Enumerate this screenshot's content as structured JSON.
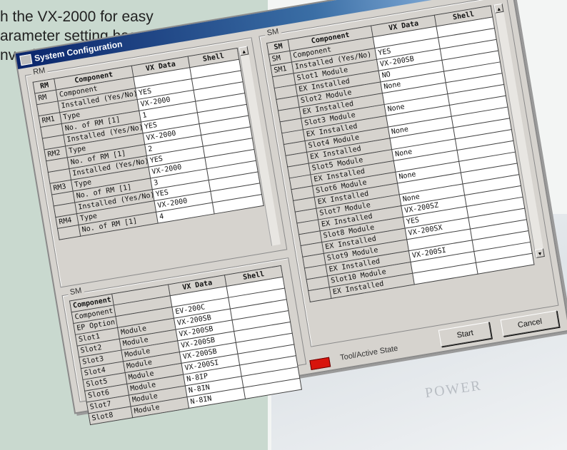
{
  "intro_lines": [
    "h the VX-2000 for easy",
    "arameter setting has",
    "nvenient use by"
  ],
  "background_text": "POWER",
  "window": {
    "title": "System Configuration",
    "close_label": "×",
    "start_label": "Start",
    "cancel_label": "Cancel",
    "status_label": "Tool/Active State",
    "status_color": "#d8140c"
  },
  "panel_left_top": {
    "label": "RM",
    "headers": [
      "RM",
      "Component",
      "VX Data",
      "Shell"
    ],
    "rows": [
      {
        "group": "RM",
        "item": "Component",
        "data": "",
        "shell": ""
      },
      {
        "group": "",
        "item": "Installed (Yes/No)",
        "data": "YES",
        "shell": ""
      },
      {
        "group": "RM1",
        "item": "Type",
        "data": "VX-2000",
        "shell": ""
      },
      {
        "group": "",
        "item": "No. of RM [1]",
        "data": "1",
        "shell": ""
      },
      {
        "group": "",
        "item": "Installed (Yes/No)",
        "data": "YES",
        "shell": ""
      },
      {
        "group": "RM2",
        "item": "Type",
        "data": "VX-2000",
        "shell": ""
      },
      {
        "group": "",
        "item": "No. of RM [1]",
        "data": "2",
        "shell": ""
      },
      {
        "group": "",
        "item": "Installed (Yes/No)",
        "data": "YES",
        "shell": ""
      },
      {
        "group": "RM3",
        "item": "Type",
        "data": "VX-2000",
        "shell": ""
      },
      {
        "group": "",
        "item": "No. of RM [1]",
        "data": "3",
        "shell": ""
      },
      {
        "group": "",
        "item": "Installed (Yes/No)",
        "data": "YES",
        "shell": ""
      },
      {
        "group": "RM4",
        "item": "Type",
        "data": "VX-2000",
        "shell": ""
      },
      {
        "group": "",
        "item": "No. of RM [1]",
        "data": "4",
        "shell": ""
      }
    ]
  },
  "panel_left_bottom": {
    "label": "SM",
    "headers": [
      "Component",
      "",
      "VX Data",
      "Shell"
    ],
    "rows": [
      {
        "a": "Component",
        "b": "",
        "data": "",
        "shell": ""
      },
      {
        "a": "EP Option",
        "b": "",
        "data": "EV-200C",
        "shell": ""
      },
      {
        "a": "Slot1",
        "b": "Module",
        "data": "VX-200SB",
        "shell": ""
      },
      {
        "a": "Slot2",
        "b": "Module",
        "data": "VX-200SB",
        "shell": ""
      },
      {
        "a": "Slot3",
        "b": "Module",
        "data": "VX-200SB",
        "shell": ""
      },
      {
        "a": "Slot4",
        "b": "Module",
        "data": "VX-200SB",
        "shell": ""
      },
      {
        "a": "Slot5",
        "b": "Module",
        "data": "VX-200SI",
        "shell": ""
      },
      {
        "a": "Slot6",
        "b": "Module",
        "data": "N-8IP",
        "shell": ""
      },
      {
        "a": "Slot7",
        "b": "Module",
        "data": "N-8IN",
        "shell": ""
      },
      {
        "a": "Slot8",
        "b": "Module",
        "data": "N-8IN",
        "shell": ""
      }
    ]
  },
  "panel_right": {
    "label": "SM",
    "headers": [
      "SM",
      "Component",
      "VX Data",
      "Shell"
    ],
    "rows": [
      {
        "group": "SM",
        "item": "Component",
        "data": "",
        "shell": ""
      },
      {
        "group": "SM1",
        "item": "Installed (Yes/No)",
        "data": "YES",
        "shell": ""
      },
      {
        "group": "",
        "item": "Slot1  Module",
        "data": "VX-200SB",
        "shell": ""
      },
      {
        "group": "",
        "item": "EX Installed",
        "data": "NO",
        "shell": ""
      },
      {
        "group": "",
        "item": "Slot2  Module",
        "data": "None",
        "shell": ""
      },
      {
        "group": "",
        "item": "EX Installed",
        "data": "",
        "shell": ""
      },
      {
        "group": "",
        "item": "Slot3  Module",
        "data": "None",
        "shell": ""
      },
      {
        "group": "",
        "item": "EX Installed",
        "data": "",
        "shell": ""
      },
      {
        "group": "",
        "item": "Slot4  Module",
        "data": "None",
        "shell": ""
      },
      {
        "group": "",
        "item": "EX Installed",
        "data": "",
        "shell": ""
      },
      {
        "group": "",
        "item": "Slot5  Module",
        "data": "None",
        "shell": ""
      },
      {
        "group": "",
        "item": "EX Installed",
        "data": "",
        "shell": ""
      },
      {
        "group": "",
        "item": "Slot6  Module",
        "data": "None",
        "shell": ""
      },
      {
        "group": "",
        "item": "EX Installed",
        "data": "",
        "shell": ""
      },
      {
        "group": "",
        "item": "Slot7  Module",
        "data": "None",
        "shell": ""
      },
      {
        "group": "",
        "item": "EX Installed",
        "data": "VX-200SZ",
        "shell": ""
      },
      {
        "group": "",
        "item": "Slot8  Module",
        "data": "YES",
        "shell": ""
      },
      {
        "group": "",
        "item": "EX Installed",
        "data": "VX-200SX",
        "shell": ""
      },
      {
        "group": "",
        "item": "Slot9  Module",
        "data": "",
        "shell": ""
      },
      {
        "group": "",
        "item": "EX Installed",
        "data": "VX-200SI",
        "shell": ""
      },
      {
        "group": "",
        "item": "Slot10 Module",
        "data": "",
        "shell": ""
      },
      {
        "group": "",
        "item": "EX Installed",
        "data": "",
        "shell": ""
      }
    ]
  },
  "scroll_up": "▲",
  "scroll_down": "▼"
}
